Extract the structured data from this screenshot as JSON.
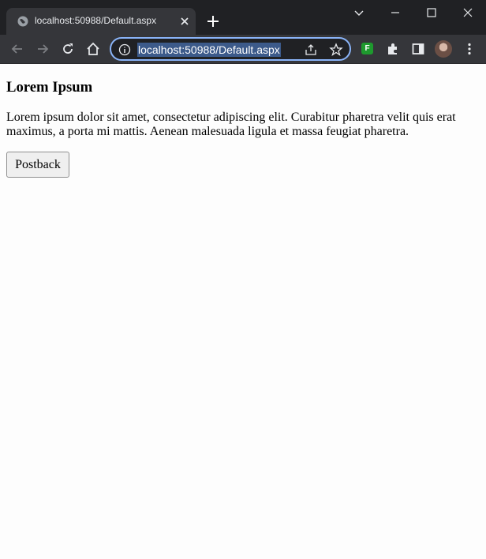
{
  "browser": {
    "tab": {
      "title": "localhost:50988/Default.aspx",
      "favicon": "globe-icon"
    },
    "address_bar": {
      "url": "localhost:50988/Default.aspx"
    },
    "toolbar_icons": [
      "back-icon",
      "forward-icon",
      "reload-icon",
      "home-icon",
      "info-icon",
      "share-icon",
      "star-icon",
      "extension-f-icon",
      "puzzle-icon",
      "sidepanel-icon",
      "profile-avatar",
      "menu-icon"
    ],
    "extension_label": "F",
    "colors": {
      "tabstrip": "#202124",
      "toolbar": "#35363a",
      "omnibox_focus": "#8ab4f8",
      "url_selection": "#3c5a8a"
    }
  },
  "page": {
    "heading": "Lorem Ipsum",
    "paragraph": "Lorem ipsum dolor sit amet, consectetur adipiscing elit. Curabitur pharetra velit quis erat maximus, a porta mi mattis. Aenean malesuada ligula et massa feugiat pharetra.",
    "button_label": "Postback"
  }
}
